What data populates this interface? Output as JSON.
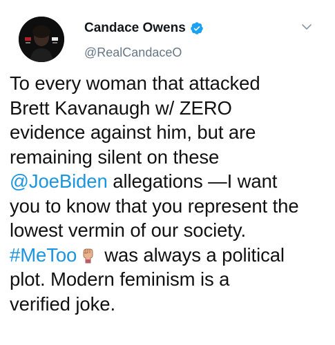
{
  "tweet": {
    "author": {
      "display_name": "Candace Owens",
      "handle": "@RealCandaceO",
      "verified": true,
      "avatar_icon": "profile-photo"
    },
    "menu_icon": "chevron-down-icon",
    "text_lines": [
      {
        "segments": [
          {
            "text": "To every woman that attacked",
            "type": "text"
          }
        ]
      },
      {
        "segments": [
          {
            "text": "Brett Kavanaugh w/ ZERO",
            "type": "text"
          }
        ]
      },
      {
        "segments": [
          {
            "text": "evidence against him, but are",
            "type": "text"
          }
        ]
      },
      {
        "segments": [
          {
            "text": "remaining silent  on these",
            "type": "text"
          }
        ]
      },
      {
        "segments": [
          {
            "text": "@JoeBiden",
            "type": "mention"
          },
          {
            "text": " allegations —I want",
            "type": "text"
          }
        ]
      },
      {
        "segments": [
          {
            "text": "you to know that you represent the",
            "type": "text"
          }
        ]
      },
      {
        "segments": [
          {
            "text": "lowest vermin of our society.",
            "type": "text"
          }
        ]
      },
      {
        "segments": [
          {
            "text": "#MeToo",
            "type": "hashtag"
          },
          {
            "text": "",
            "type": "emoji",
            "icon": "raised-fist-emoji-icon"
          },
          {
            "text": "was always a political",
            "type": "text"
          }
        ]
      },
      {
        "segments": [
          {
            "text": "plot. Modern feminism is a",
            "type": "text"
          }
        ]
      },
      {
        "segments": [
          {
            "text": "verified joke.",
            "type": "text"
          }
        ]
      }
    ],
    "colors": {
      "link": "#1b95e0",
      "verified_badge": "#1da1f2",
      "secondary_text": "#657786"
    }
  }
}
